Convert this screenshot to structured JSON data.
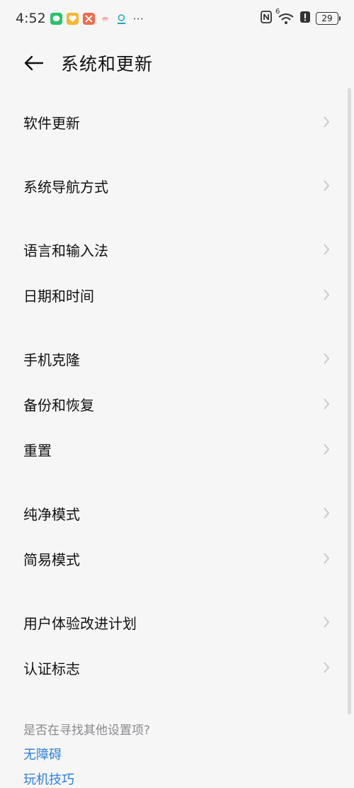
{
  "status_bar": {
    "time": "4:52",
    "more_indicator": "···",
    "network_superscript": "6",
    "battery": "29",
    "notification_icons": [
      "wechat-icon",
      "favorites-icon",
      "tools-icon",
      "toast-icon",
      "profile-icon"
    ],
    "right_icons": [
      "nfc-icon",
      "wifi-icon",
      "alert-icon",
      "battery-icon"
    ]
  },
  "header": {
    "title": "系统和更新",
    "back_icon": "back-arrow-icon"
  },
  "menu_items": [
    "软件更新",
    "系统导航方式",
    "语言和输入法",
    "日期和时间",
    "手机克隆",
    "备份和恢复",
    "重置",
    "纯净模式",
    "简易模式",
    "用户体验改进计划",
    "认证标志"
  ],
  "footer": {
    "prompt": "是否在寻找其他设置项?",
    "links": [
      "无障碍",
      "玩机技巧"
    ]
  },
  "colors": {
    "background": "#f6f6f7",
    "link": "#2d7fe0",
    "text": "#111111",
    "muted": "#8a8a8e",
    "chevron": "#c8c8cc"
  }
}
